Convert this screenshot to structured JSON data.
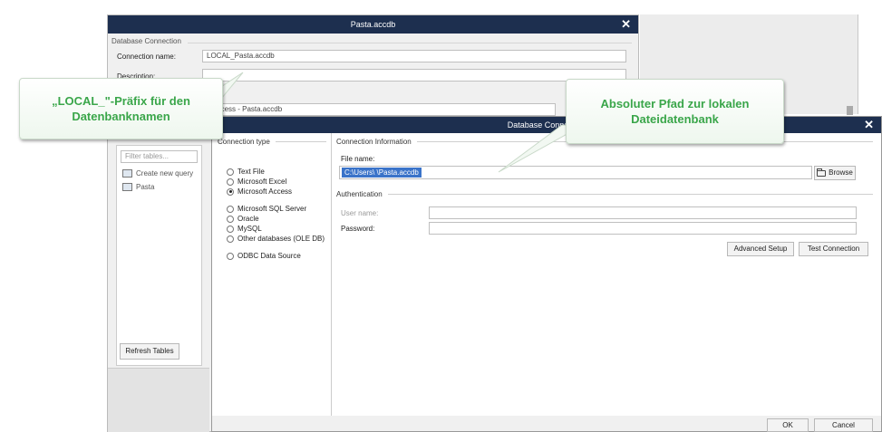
{
  "back_window": {
    "title": "Pasta.accdb",
    "group_label": "Database Connection",
    "connection_name_label": "Connection name:",
    "connection_name_value": "LOCAL_Pasta.accdb",
    "description_label": "Description:",
    "source_value": "ft Access - Pasta.accdb",
    "filter_placeholder": "Filter tables...",
    "tree_items": [
      {
        "label": "Create new query",
        "icon": "query-icon"
      },
      {
        "label": "Pasta",
        "icon": "table-icon"
      }
    ],
    "refresh_label": "Refresh Tables"
  },
  "dialog": {
    "title": "Database Connection",
    "connection_type_label": "Connection type",
    "connection_types": [
      {
        "label": "Text File",
        "selected": false
      },
      {
        "label": "Microsoft Excel",
        "selected": false
      },
      {
        "label": "Microsoft Access",
        "selected": true
      },
      {
        "label": "Microsoft SQL Server",
        "selected": false
      },
      {
        "label": "Oracle",
        "selected": false
      },
      {
        "label": "MySQL",
        "selected": false
      },
      {
        "label": "Other databases (OLE DB)",
        "selected": false
      },
      {
        "label": "ODBC Data Source",
        "selected": false
      }
    ],
    "connection_info_label": "Connection Information",
    "file_name_label": "File name:",
    "file_name_value": "C:\\Users\\                                              \\Pasta.accdb",
    "browse_label": "Browse",
    "authentication_label": "Authentication",
    "user_name_label": "User name:",
    "password_label": "Password:",
    "advanced_setup_label": "Advanced Setup",
    "test_connection_label": "Test Connection",
    "ok_label": "OK",
    "cancel_label": "Cancel"
  },
  "callouts": {
    "left": "„LOCAL_\"-Präfix für den Datenbanknamen",
    "right": "Absoluter Pfad zur lokalen Dateidatenbank"
  },
  "colors": {
    "title_bar": "#1d2f4f",
    "selection": "#3a73c9",
    "callout_text": "#3aa64a"
  }
}
